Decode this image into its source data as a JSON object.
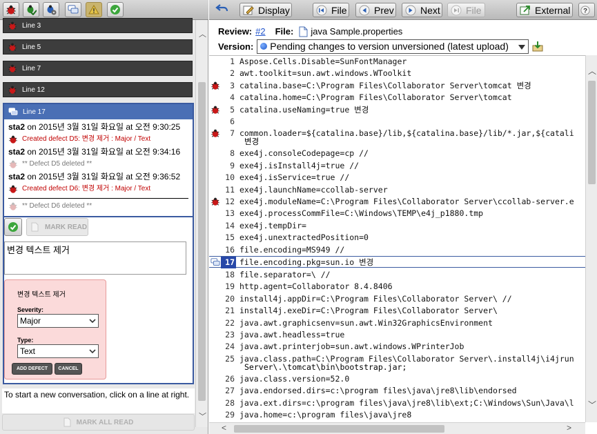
{
  "left_toolbar": {
    "buttons": [
      "bug-icon",
      "bug-check-icon",
      "bug-gear-icon",
      "chat-icon",
      "warning-icon",
      "check-icon"
    ]
  },
  "line_markers": [
    {
      "label": "Line 3"
    },
    {
      "label": "Line 5"
    },
    {
      "label": "Line 7"
    },
    {
      "label": "Line 12"
    }
  ],
  "thread": {
    "header": "Line 17",
    "messages": [
      {
        "author": "sta2",
        "time": " on 2015년 3월 31일 화요일 at 오전 9:30:25",
        "event": "Created defect D5: 변경 제거 : Major / Text",
        "event_type": "red"
      },
      {
        "author": "sta2",
        "time": " on 2015년 3월 31일 화요일 at 오전 9:34:16",
        "event": "** Defect D5 deleted **",
        "event_type": "gray"
      },
      {
        "author": "sta2",
        "time": " on 2015년 3월 31일 화요일 at 오전 9:36:52",
        "event": "Created defect D6: 변경 제거 : Major / Text",
        "event_type": "red"
      }
    ],
    "last_event": "** Defect D6 deleted **",
    "mark_read_label": "MARK READ",
    "comment_text": "변경 텍스트 제거",
    "defect_form": {
      "title": "변경 텍스트 제거",
      "severity_label": "Severity:",
      "severity_value": "Major",
      "type_label": "Type:",
      "type_value": "Text",
      "add_label": "ADD DEFECT",
      "cancel_label": "CANCEL"
    }
  },
  "start_conversation_text": "To start a new conversation, click on a line at right.",
  "mark_all_read_label": "MARK ALL READ",
  "right_toolbar": {
    "display": "Display",
    "file": "File",
    "prev": "Prev",
    "next": "Next",
    "file_disabled": "File",
    "external": "External"
  },
  "review": {
    "label": "Review:",
    "id": "#2",
    "file_label": "File:",
    "file_name": "java Sample.properties",
    "version_label": "Version:",
    "version_value": "Pending changes to version unversioned (latest upload)"
  },
  "code_lines": [
    {
      "n": "1",
      "text": "Aspose.Cells.Disable=SunFontManager",
      "bug": false
    },
    {
      "n": "2",
      "text": "awt.toolkit=sun.awt.windows.WToolkit",
      "bug": false
    },
    {
      "n": "3",
      "text": "catalina.base=C:\\Program Files\\Collaborator Server\\tomcat 변경",
      "bug": true
    },
    {
      "n": "4",
      "text": "catalina.home=C:\\Program Files\\Collaborator Server\\tomcat",
      "bug": false
    },
    {
      "n": "5",
      "text": "catalina.useNaming=true 변경",
      "bug": true
    },
    {
      "n": "6",
      "text": "",
      "bug": false
    },
    {
      "n": "7",
      "text": "common.loader=${catalina.base}/lib,${catalina.base}/lib/*.jar,${catali",
      "text2": "변경",
      "bug": true
    },
    {
      "n": "8",
      "text": "exe4j.consoleCodepage=cp  //",
      "bug": false
    },
    {
      "n": "9",
      "text": "exe4j.isInstall4j=true  //",
      "bug": false
    },
    {
      "n": "10",
      "text": "exe4j.isService=true //",
      "bug": false
    },
    {
      "n": "11",
      "text": "exe4j.launchName=ccollab-server",
      "bug": false
    },
    {
      "n": "12",
      "text": "exe4j.moduleName=C:\\Program Files\\Collaborator Server\\ccollab-server.e",
      "bug": true
    },
    {
      "n": "13",
      "text": "exe4j.processCommFile=C:\\Windows\\TEMP\\e4j_p1880.tmp",
      "bug": false
    },
    {
      "n": "14",
      "text": "exe4j.tempDir=",
      "bug": false
    },
    {
      "n": "15",
      "text": "exe4j.unextractedPosition=0",
      "bug": false
    },
    {
      "n": "16",
      "text": "file.encoding=MS949 //",
      "bug": false
    },
    {
      "n": "17",
      "text": "file.encoding.pkg=sun.io 변경",
      "bug": false,
      "selected": true
    },
    {
      "n": "18",
      "text": "file.separator=\\  //",
      "bug": false
    },
    {
      "n": "19",
      "text": "http.agent=Collaborator 8.4.8406",
      "bug": false
    },
    {
      "n": "20",
      "text": "install4j.appDir=C:\\Program Files\\Collaborator Server\\  //",
      "bug": false
    },
    {
      "n": "21",
      "text": "install4j.exeDir=C:\\Program Files\\Collaborator Server\\",
      "bug": false
    },
    {
      "n": "22",
      "text": "java.awt.graphicsenv=sun.awt.Win32GraphicsEnvironment",
      "bug": false
    },
    {
      "n": "23",
      "text": "java.awt.headless=true",
      "bug": false
    },
    {
      "n": "24",
      "text": "java.awt.printerjob=sun.awt.windows.WPrinterJob",
      "bug": false
    },
    {
      "n": "25",
      "text": "java.class.path=C:\\Program Files\\Collaborator Server\\.install4j\\i4jrun",
      "text2": "Server\\.\\tomcat\\bin\\bootstrap.jar;",
      "bug": false
    },
    {
      "n": "26",
      "text": "java.class.version=52.0",
      "bug": false
    },
    {
      "n": "27",
      "text": "java.endorsed.dirs=c:\\program files\\java\\jre8\\lib\\endorsed",
      "bug": false
    },
    {
      "n": "28",
      "text": "java.ext.dirs=c:\\program files\\java\\jre8\\lib\\ext;C:\\Windows\\Sun\\Java\\l",
      "bug": false
    },
    {
      "n": "29",
      "text": "java.home=c:\\program files\\java\\jre8",
      "bug": false
    }
  ],
  "colors": {
    "toolbar_bg": "#c9c9c9",
    "thread_border": "#3a5aa0",
    "thread_header": "#4a6fb5",
    "defect_red": "#c00000",
    "defect_form_bg": "#fbdada",
    "selected_line": "#2848a8",
    "link": "#2255cc"
  }
}
